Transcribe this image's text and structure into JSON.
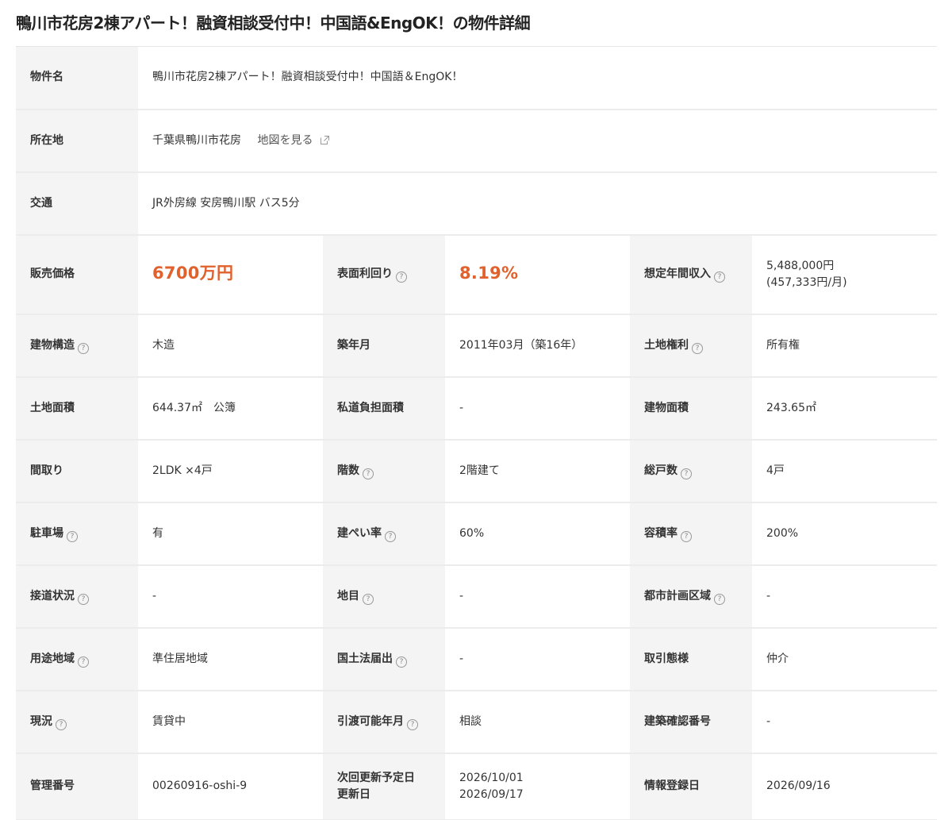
{
  "page": {
    "title": "鴨川市花房2棟アパート！融資相談受付中！中国語&EngOK！の物件詳細"
  },
  "property": {
    "name_label": "物件名",
    "name": "鴨川市花房2棟アパート！融資相談受付中！中国語＆EngOK！",
    "location_label": "所在地",
    "location": "千葉県鴨川市花房",
    "map_link": "地図を見る",
    "transport_label": "交通",
    "transport": "JR外房線 安房鴨川駅 バス5分",
    "price_label": "販売価格",
    "price": "6700万円",
    "yield_label": "表面利回り",
    "yield": "8.19%",
    "income_label": "想定年間収入",
    "income_annual": "5,488,000円",
    "income_monthly": "(457,333円/月)",
    "structure_label": "建物構造",
    "structure": "木造",
    "built_label": "築年月",
    "built": "2011年03月（築16年）",
    "land_rights_label": "土地権利",
    "land_rights": "所有権",
    "land_area_label": "土地面積",
    "land_area": "644.37㎡　公簿",
    "private_road_label": "私道負担面積",
    "private_road": "-",
    "building_area_label": "建物面積",
    "building_area": "243.65㎡",
    "layout_label": "間取り",
    "layout": "2LDK ×4戸",
    "floors_label": "階数",
    "floors": "2階建て",
    "units_label": "総戸数",
    "units": "4戸",
    "parking_label": "駐車場",
    "parking": "有",
    "coverage_label": "建ぺい率",
    "coverage": "60%",
    "far_label": "容積率",
    "far": "200%",
    "road_label": "接道状況",
    "road": "-",
    "land_category_label": "地目",
    "land_category": "-",
    "city_planning_label": "都市計画区域",
    "city_planning": "-",
    "zoning_label": "用途地域",
    "zoning": "準住居地域",
    "national_land_label": "国土法届出",
    "national_land": "-",
    "transaction_label": "取引態様",
    "transaction": "仲介",
    "status_label": "現況",
    "status": "賃貸中",
    "handover_label": "引渡可能年月",
    "handover": "相談",
    "building_confirm_label": "建築確認番号",
    "building_confirm": "-",
    "management_label": "管理番号",
    "management": "00260916-oshi-9",
    "next_update_label": "次回更新予定日",
    "updated_label": "更新日",
    "next_update": "2026/10/01",
    "updated": "2026/09/17",
    "registered_label": "情報登録日",
    "registered": "2026/09/16"
  },
  "icons": {
    "help": "question-circle-icon",
    "map": "external-link-icon",
    "help_glyph": "?"
  },
  "colors": {
    "price": "#e0612c",
    "header_bg": "#f4f4f4",
    "border": "#ececec"
  }
}
